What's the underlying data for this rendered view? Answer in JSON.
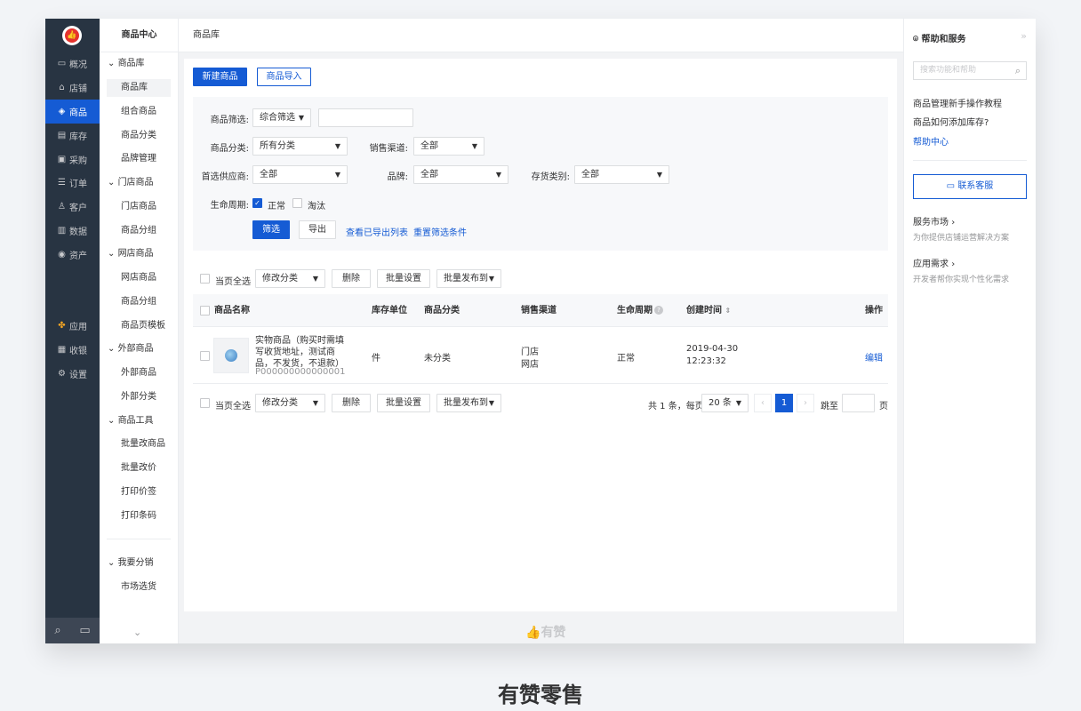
{
  "sidebar": {
    "items": [
      {
        "icon": "monitor-icon",
        "glyph": "▭",
        "label": "概况"
      },
      {
        "icon": "shop-icon",
        "glyph": "⌂",
        "label": "店铺"
      },
      {
        "icon": "tag-icon",
        "glyph": "◈",
        "label": "商品"
      },
      {
        "icon": "inventory-icon",
        "glyph": "▤",
        "label": "库存"
      },
      {
        "icon": "purchase-icon",
        "glyph": "▣",
        "label": "采购"
      },
      {
        "icon": "order-icon",
        "glyph": "☰",
        "label": "订单"
      },
      {
        "icon": "customer-icon",
        "glyph": "♙",
        "label": "客户"
      },
      {
        "icon": "data-icon",
        "glyph": "▥",
        "label": "数据"
      },
      {
        "icon": "asset-icon",
        "glyph": "◉",
        "label": "资产"
      },
      {
        "icon": "apps-icon",
        "glyph": "✤",
        "label": "应用"
      },
      {
        "icon": "cashier-icon",
        "glyph": "▦",
        "label": "收银"
      },
      {
        "icon": "settings-icon",
        "glyph": "⚙",
        "label": "设置"
      }
    ]
  },
  "subnav": {
    "title": "商品中心",
    "groups": [
      {
        "label": "商品库",
        "items": [
          "商品库",
          "组合商品",
          "商品分类",
          "品牌管理"
        ]
      },
      {
        "label": "门店商品",
        "items": [
          "门店商品",
          "商品分组"
        ]
      },
      {
        "label": "网店商品",
        "items": [
          "网店商品",
          "商品分组",
          "商品页模板"
        ]
      },
      {
        "label": "外部商品",
        "items": [
          "外部商品",
          "外部分类"
        ]
      },
      {
        "label": "商品工具",
        "items": [
          "批量改商品",
          "批量改价",
          "打印价签",
          "打印条码"
        ]
      },
      {
        "label": "我要分销",
        "items": [
          "市场选货"
        ]
      }
    ]
  },
  "header": {
    "title": "商品库"
  },
  "toolbar": {
    "new_label": "新建商品",
    "import_label": "商品导入"
  },
  "filter": {
    "goods_filter_label": "商品筛选:",
    "goods_filter_value": "综合筛选",
    "category_label": "商品分类:",
    "category_value": "所有分类",
    "channel_label": "销售渠道:",
    "channel_value": "全部",
    "supplier_label": "首选供应商:",
    "supplier_value": "全部",
    "brand_label": "品牌:",
    "brand_value": "全部",
    "stock_type_label": "存货类别:",
    "stock_type_value": "全部",
    "lifecycle_label": "生命周期:",
    "lifecycle_normal": "正常",
    "lifecycle_obsolete": "淘汰",
    "filter_btn": "筛选",
    "export_btn": "导出",
    "view_exports": "查看已导出列表",
    "reset": "重置筛选条件"
  },
  "bulk": {
    "select_all": "当页全选",
    "modify_category": "修改分类",
    "delete": "删除",
    "batch_settings": "批量设置",
    "batch_publish": "批量发布到"
  },
  "table": {
    "columns": [
      "商品名称",
      "库存单位",
      "商品分类",
      "销售渠道",
      "生命周期",
      "创建时间",
      "操作"
    ],
    "rows": [
      {
        "name_line1": "实物商品（购买时需填",
        "name_line2": "写收货地址，测试商",
        "name_line3": "品，不发货，不退款）",
        "code": "P000000000000001",
        "unit": "件",
        "category": "未分类",
        "channel1": "门店",
        "channel2": "网店",
        "lifecycle": "正常",
        "date": "2019-04-30",
        "time": "12:23:32",
        "action": "编辑"
      }
    ]
  },
  "pagination": {
    "total": "共 1 条，每页",
    "page_size": "20 条",
    "current": "1",
    "goto": "跳至",
    "page_unit": "页"
  },
  "footer": {
    "brand": "有赞"
  },
  "help": {
    "title": "帮助和服务",
    "search_placeholder": "搜索功能和帮助",
    "link1": "商品管理新手操作教程",
    "link2": "商品如何添加库存?",
    "link3": "帮助中心",
    "contact": "联系客服",
    "market_title": "服务市场",
    "market_sub": "为你提供店铺运营解决方案",
    "app_title": "应用需求",
    "app_sub": "开发者帮你实现个性化需求"
  },
  "caption": "有赞零售",
  "colors": {
    "accent": "#155bd4",
    "sidebar_bg": "#283442"
  }
}
